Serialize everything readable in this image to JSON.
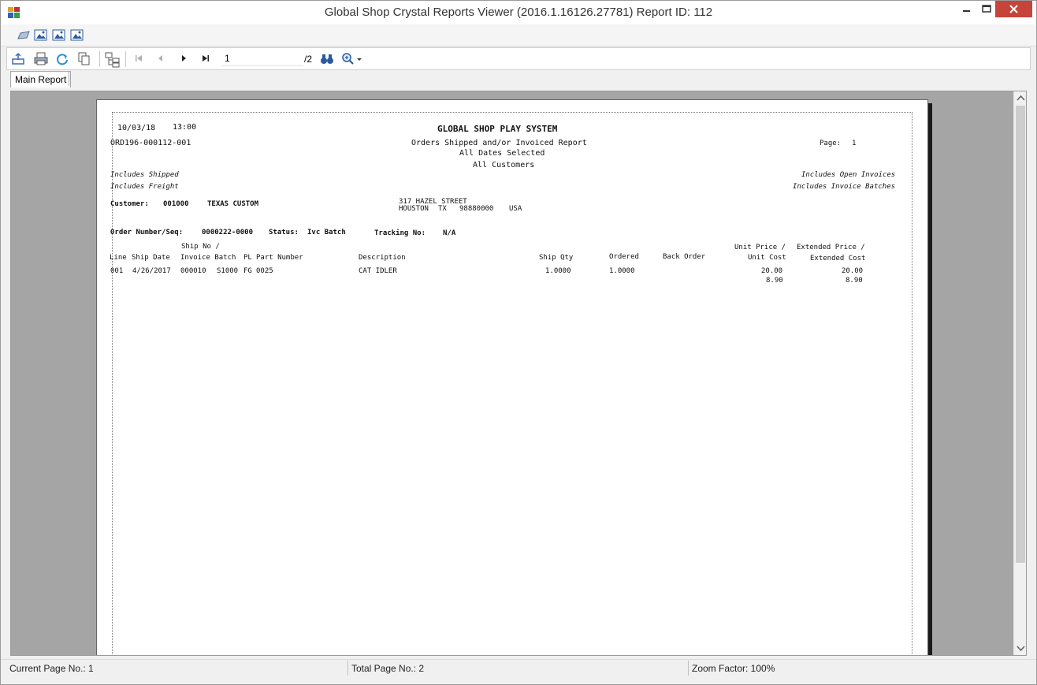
{
  "window": {
    "title": "Global Shop Crystal Reports Viewer (2016.1.16126.27781) Report ID: 112"
  },
  "toolbar": {
    "page_number_value": "1",
    "page_total": "/2"
  },
  "tabs": [
    {
      "label": "Main Report"
    }
  ],
  "report": {
    "date": "10/03/18",
    "time": "13:00",
    "company": "GLOBAL SHOP PLAY SYSTEM",
    "report_id": "ORD196-000112-001",
    "report_title": "Orders Shipped and/or Invoiced Report",
    "date_filter": "All Dates Selected",
    "customer_filter": "All Customers",
    "page_label": "Page:",
    "page_value": "1",
    "include_left": [
      "Includes Shipped",
      "Includes Freight"
    ],
    "include_right": [
      "Includes Open Invoices",
      "Includes Invoice Batches"
    ],
    "customer_label": "Customer:",
    "customer_code": "001000",
    "customer_name": "TEXAS CUSTOM",
    "address_line1": "317 HAZEL STREET",
    "address_city": "HOUSTON",
    "address_state": "TX",
    "address_zip": "98880000",
    "address_country": "USA",
    "order_label": "Order Number/Seq:",
    "order_value": "0000222-0000",
    "status_label": "Status:",
    "status_value": "Ivc Batch",
    "tracking_label": "Tracking No:",
    "tracking_value": "N/A",
    "columns": {
      "ship_no_top": "Ship No /",
      "line": "Line",
      "ship_date": "Ship Date",
      "invoice_batch": "Invoice Batch",
      "pl": "PL",
      "part_number": "Part Number",
      "description": "Description",
      "ship_qty": "Ship Qty",
      "ordered": "Ordered",
      "back_order": "Back Order",
      "unit_price_top": "Unit Price /",
      "unit_cost": "Unit Cost",
      "ext_price_top": "Extended Price /",
      "ext_cost": "Extended Cost"
    },
    "rows": [
      {
        "line": "001",
        "ship_date": "4/26/2017",
        "invoice": "000010",
        "batch": "S1000",
        "pl": "FG",
        "part": "0025",
        "description": "CAT IDLER",
        "ship_qty": "1.0000",
        "ordered": "1.0000",
        "unit_price": "20.00",
        "unit_cost": "8.90",
        "ext_price": "20.00",
        "ext_cost": "8.90"
      }
    ]
  },
  "status_bar": {
    "current_page": "Current Page No.: 1",
    "total_page": "Total Page No.: 2",
    "zoom": "Zoom Factor: 100%"
  },
  "icons": {
    "app": "crystal-reports-app-icon",
    "export": "export-icon",
    "print": "print-icon",
    "refresh": "refresh-icon",
    "copy": "copy-icon",
    "group_tree": "group-tree-icon",
    "first": "first-page-icon",
    "prev": "previous-page-icon",
    "next": "next-page-icon",
    "last": "last-page-icon",
    "find": "find-binoculars-icon",
    "zoom": "zoom-icon"
  },
  "colors": {
    "close_button": "#c7443a",
    "viewer_background": "#a5a5a5"
  }
}
